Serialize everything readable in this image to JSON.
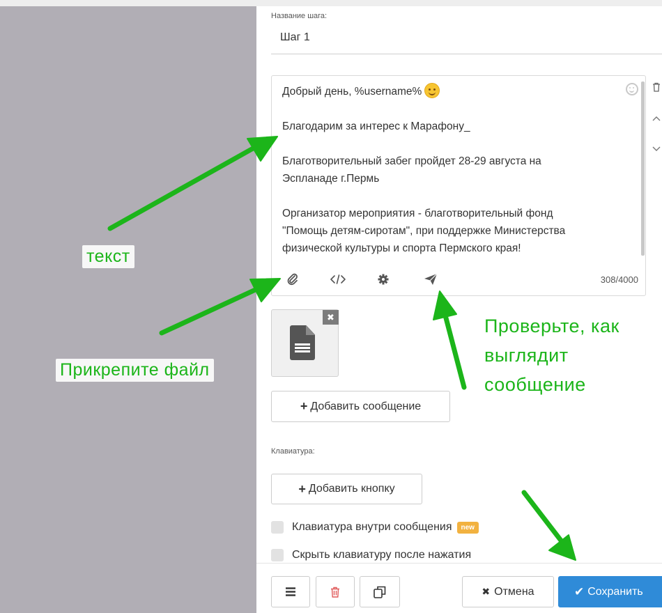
{
  "step": {
    "label": "Название шага:",
    "value": "Шаг 1"
  },
  "editor": {
    "lines": [
      "Добрый день, %username%",
      "",
      "Благодарим за интерес к Марафону_",
      "",
      "Благотворительный забег пройдет 28-29 августа на",
      "Эспланаде г.Пермь",
      "",
      "Организатор мероприятия - благотворительный фонд",
      "\"Помощь детям-сиротам\", при поддержке Министерства",
      "физической культуры и спорта Пермского края!"
    ],
    "counter": "308/4000",
    "toolbar_icons": [
      "paperclip-icon",
      "code-icon",
      "gear-icon",
      "paper-plane-icon"
    ]
  },
  "buttons": {
    "add_message": "Добавить сообщение",
    "add_button": "Добавить кнопку",
    "cancel": "Отмена",
    "save": "Сохранить"
  },
  "keyboard": {
    "label": "Клавиатура:",
    "options": [
      {
        "label": "Клавиатура внутри сообщения",
        "badge": "new",
        "checked": false
      },
      {
        "label": "Скрыть клавиатуру после нажатия",
        "checked": false
      }
    ]
  },
  "annotations": {
    "text_label": "текст",
    "attach_label": "Прикрепите файл",
    "preview_line1": "Проверьте, как",
    "preview_line2": "выглядит",
    "preview_line3": "сообщение"
  },
  "colors": {
    "annotation_green": "#1cb51a",
    "save_blue": "#2f8bd8",
    "sidebar_gray": "#b1aeb5",
    "new_badge": "#f2b240"
  }
}
